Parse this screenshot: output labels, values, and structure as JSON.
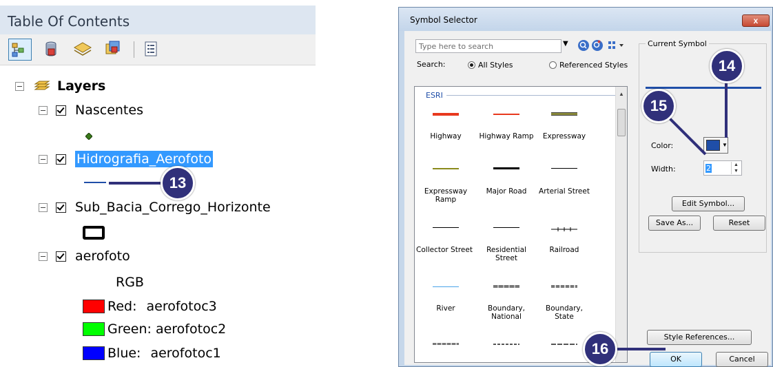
{
  "toc": {
    "title": "Table Of Contents",
    "toolbar": [
      "list-by-drawing-order-icon",
      "list-by-source-icon",
      "list-by-visibility-icon",
      "list-by-selection-icon",
      "options-icon"
    ],
    "layers_label": "Layers",
    "items": [
      {
        "name": "Nascentes"
      },
      {
        "name": "Hidrografia_Aerofoto"
      },
      {
        "name": "Sub_Bacia_Corrego_Horizonte"
      },
      {
        "name": "aerofoto"
      }
    ],
    "rgb_label": "RGB",
    "bands": [
      {
        "label": "Red:",
        "value": "aerofotoc3",
        "color": "#ff0000"
      },
      {
        "label": "Green:",
        "value": "aerofotoc2",
        "color": "#00ff00"
      },
      {
        "label": "Blue:",
        "value": "aerofotoc1",
        "color": "#0000ff"
      }
    ]
  },
  "callouts": [
    "13",
    "14",
    "15",
    "16"
  ],
  "dialog": {
    "title": "Symbol Selector",
    "close": "x",
    "search_placeholder": "Type here to search",
    "search_label": "Search:",
    "radio_all": "All Styles",
    "radio_referenced": "Referenced Styles",
    "group": "ESRI",
    "symbols": [
      {
        "label": "Highway"
      },
      {
        "label": "Highway Ramp"
      },
      {
        "label": "Expressway"
      },
      {
        "label": "Expressway\nRamp"
      },
      {
        "label": "Major Road"
      },
      {
        "label": "Arterial Street"
      },
      {
        "label": "Collector Street"
      },
      {
        "label": "Residential\nStreet"
      },
      {
        "label": "Railroad"
      },
      {
        "label": "River"
      },
      {
        "label": "Boundary,\nNational"
      },
      {
        "label": "Boundary,\nState"
      }
    ],
    "current_symbol_label": "Current Symbol",
    "color_label": "Color:",
    "color_value": "#1f4ea8",
    "width_label": "Width:",
    "width_value": "2",
    "edit_symbol": "Edit Symbol...",
    "save_as": "Save As...",
    "reset": "Reset",
    "style_references": "Style References...",
    "ok": "OK",
    "cancel": "Cancel"
  }
}
